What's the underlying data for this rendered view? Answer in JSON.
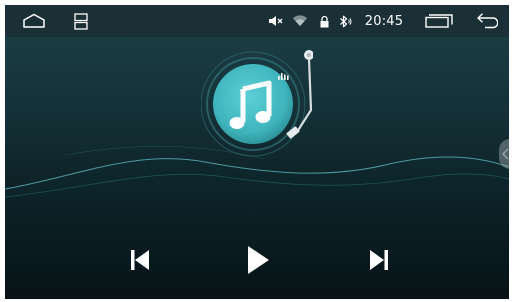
{
  "status_bar": {
    "time": "20:45",
    "icons": {
      "home": "home-icon",
      "split_screen": "split-screen-icon",
      "mute": "volume-mute-icon",
      "wifi": "wifi-icon",
      "lock": "lock-icon",
      "bluetooth": "bluetooth-icon",
      "recent_apps": "recent-apps-icon",
      "back": "back-arrow-icon"
    }
  },
  "player": {
    "album_art_icon": "music-note-icon",
    "controls": {
      "previous": "previous-track-icon",
      "play": "play-icon",
      "next": "next-track-icon"
    }
  },
  "colors": {
    "accent_teal": "#3fb4bc",
    "status_bar_bg": "#1b3036",
    "screen_bg": "#143238"
  }
}
